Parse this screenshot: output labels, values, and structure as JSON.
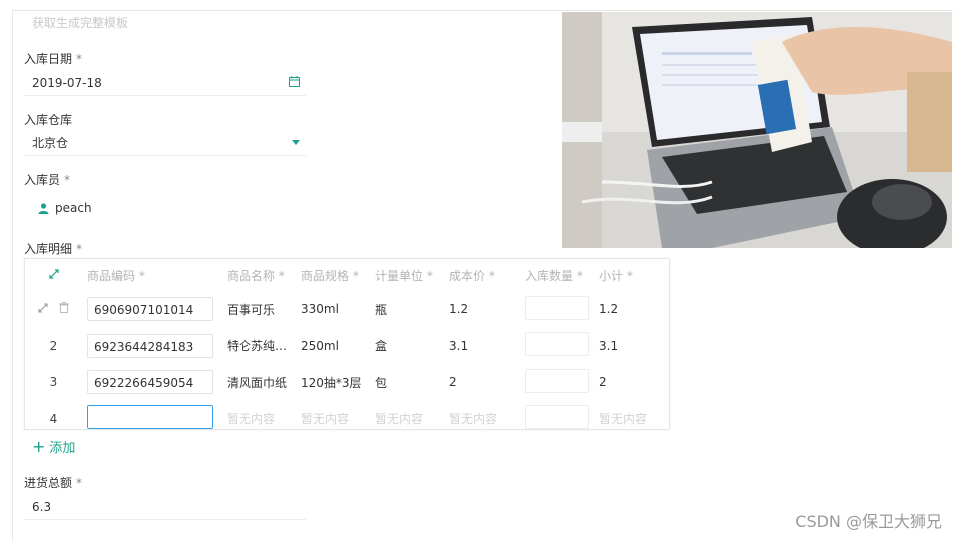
{
  "form": {
    "faded_header": "获取生成完整模板",
    "date_label": "入库日期",
    "date_value": "2019-07-18",
    "warehouse_label": "入库仓库",
    "warehouse_value": "北京仓",
    "staff_label": "入库员",
    "staff_value": "peach",
    "detail_label": "入库明细",
    "total_label": "进货总额",
    "total_value": "6.3",
    "required_mark": "*",
    "add_label": "添加",
    "add_symbol": "+"
  },
  "table": {
    "columns": [
      "商品编码 *",
      "商品名称 *",
      "商品规格 *",
      "计量单位 *",
      "成本价 *",
      "入库数量 *",
      "小计 *"
    ],
    "rows": [
      {
        "idx": "",
        "code": "6906907101014",
        "name": "百事可乐",
        "spec": "330ml",
        "unit": "瓶",
        "cost": "1.2",
        "subtotal": "1.2"
      },
      {
        "idx": "2",
        "code": "6923644284183",
        "name": "特仑苏纯…",
        "spec": "250ml",
        "unit": "盒",
        "cost": "3.1",
        "subtotal": "3.1"
      },
      {
        "idx": "3",
        "code": "6922266459054",
        "name": "清风面巾纸",
        "spec": "120抽*3层",
        "unit": "包",
        "cost": "2",
        "subtotal": "2"
      },
      {
        "idx": "4",
        "code": "",
        "name": "暂无内容",
        "spec": "暂无内容",
        "unit": "暂无内容",
        "cost": "暂无内容",
        "subtotal": "暂无内容"
      }
    ]
  },
  "watermark": "CSDN @保卫大狮兄",
  "colors": {
    "accent": "#1aa38a",
    "focus": "#2aa3e8"
  }
}
